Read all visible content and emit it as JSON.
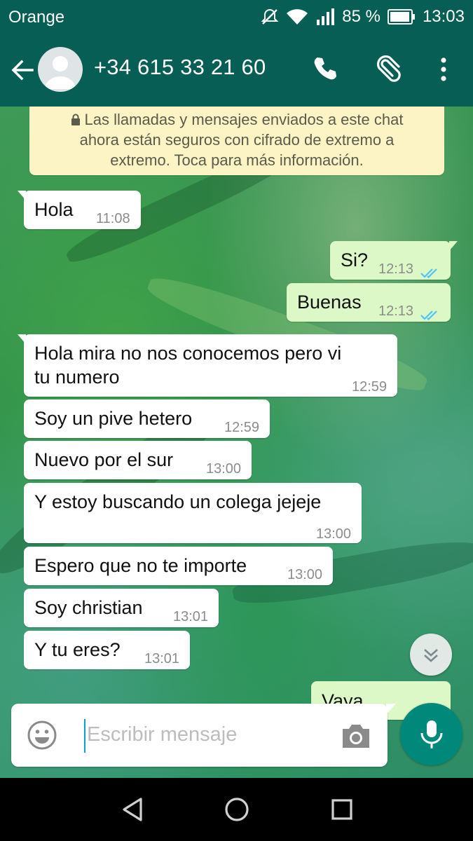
{
  "status_bar": {
    "carrier": "Orange",
    "battery": "85 %",
    "time": "13:03",
    "icons": [
      "mute-icon",
      "wifi-icon",
      "signal-icon",
      "battery-icon"
    ]
  },
  "header": {
    "contact": "+34 615 33 21 60",
    "icons": [
      "back-arrow-icon",
      "avatar-icon",
      "phone-icon",
      "attach-icon",
      "more-vert-icon"
    ]
  },
  "encryption_notice": {
    "lines": [
      "Las llamadas y mensajes enviados a este chat",
      "ahora están seguros con cifrado de extremo a",
      "extremo. Toca para más información."
    ]
  },
  "messages": [
    {
      "dir": "in",
      "text": "Hola",
      "time": "11:08"
    },
    {
      "dir": "out",
      "text": "Si?",
      "time": "12:13",
      "read": true
    },
    {
      "dir": "out",
      "text": "Buenas",
      "time": "12:13",
      "read": true
    },
    {
      "dir": "in",
      "lines": [
        "Hola mira no nos conocemos pero vi",
        "tu numero"
      ],
      "time": "12:59"
    },
    {
      "dir": "in",
      "text": "Soy un pive hetero",
      "time": "12:59"
    },
    {
      "dir": "in",
      "text": "Nuevo por el sur",
      "time": "13:00"
    },
    {
      "dir": "in",
      "text": "Y estoy buscando un colega jejeje",
      "time": "13:00"
    },
    {
      "dir": "in",
      "text": "Espero que no te importe",
      "time": "13:00"
    },
    {
      "dir": "in",
      "text": "Soy christian",
      "time": "13:01"
    },
    {
      "dir": "in",
      "text": "Y tu eres?",
      "time": "13:01"
    },
    {
      "dir": "out",
      "text": "Vaya",
      "partial": true
    }
  ],
  "composer": {
    "placeholder": "Escribir mensaje",
    "icons": [
      "emoji-icon",
      "camera-icon",
      "mic-icon"
    ]
  },
  "nav": {
    "icons": [
      "back-triangle-icon",
      "home-circle-icon",
      "recents-square-icon"
    ]
  },
  "colors": {
    "primary": "#075e54",
    "outgoing_bubble": "#dcf8c6",
    "incoming_bubble": "#ffffff",
    "notice_bg": "#fcf4c4",
    "read_ticks": "#4fc3f7",
    "mic_button": "#00897b"
  }
}
